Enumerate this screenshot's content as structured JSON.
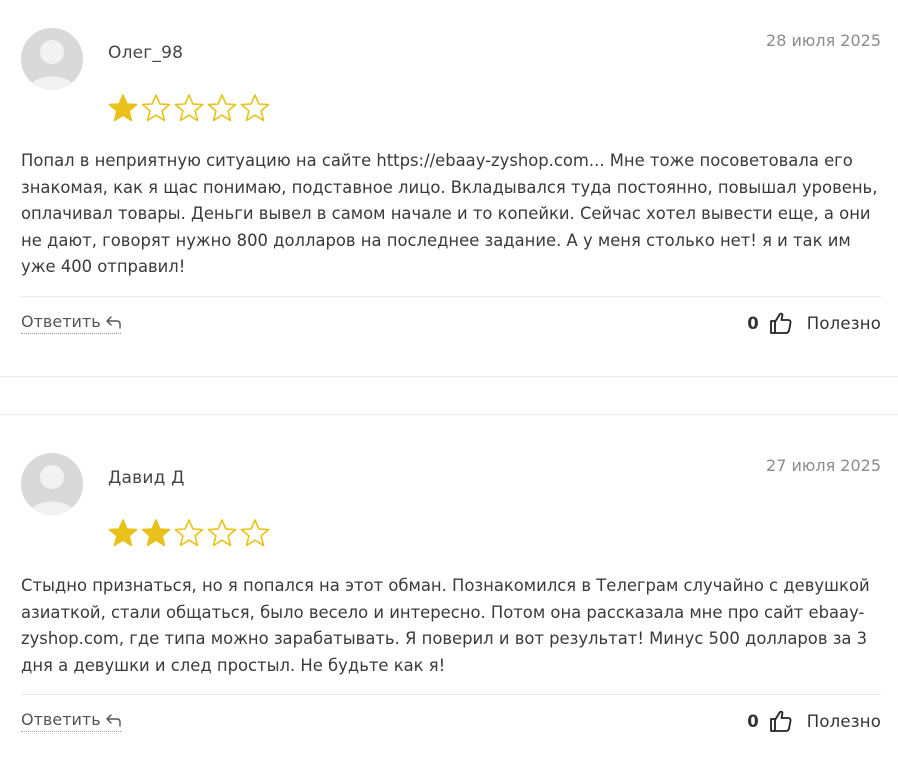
{
  "reviews": [
    {
      "author": "Олег_98",
      "date": "28 июля 2025",
      "rating": 1,
      "max_rating": 5,
      "text": "Попал в неприятную ситуацию на сайте https://ebaay-zyshop.com... Мне тоже посоветовала его знакомая, как я щас понимаю, подставное лицо. Вкладывался туда постоянно, повышал уровень, оплачивал товары. Деньги вывел в самом начале и то копейки. Сейчас хотел вывести еще, а они не дают, говорят нужно 800 долларов на последнее задание. А у меня столько нет! я и так им уже 400 отправил!",
      "reply_label": "Ответить",
      "useful_count": "0",
      "useful_label": "Полезно"
    },
    {
      "author": "Давид Д",
      "date": "27 июля 2025",
      "rating": 2,
      "max_rating": 5,
      "text": "Стыдно признаться, но я попался на этот обман. Познакомился в Телеграм случайно с девушкой азиаткой, стали общаться, было весело и интересно. Потом она рассказала мне про сайт ebaay-zyshop.com, где типа можно зарабатывать. Я поверил и вот результат! Минус 500 долларов за 3 дня а девушки и след простыл. Не будьте как я!",
      "reply_label": "Ответить",
      "useful_count": "0",
      "useful_label": "Полезно"
    }
  ],
  "icons": {
    "avatar": "user-avatar-icon",
    "star": "star-icon",
    "reply": "reply-arrow-icon",
    "thumb": "thumbs-up-icon"
  },
  "colors": {
    "star_filled": "#e8c21a",
    "star_outline": "#e8c21a",
    "avatar_bg": "#d9d9d9",
    "avatar_fg": "#f2f2f2",
    "date": "#8c8c8c"
  }
}
